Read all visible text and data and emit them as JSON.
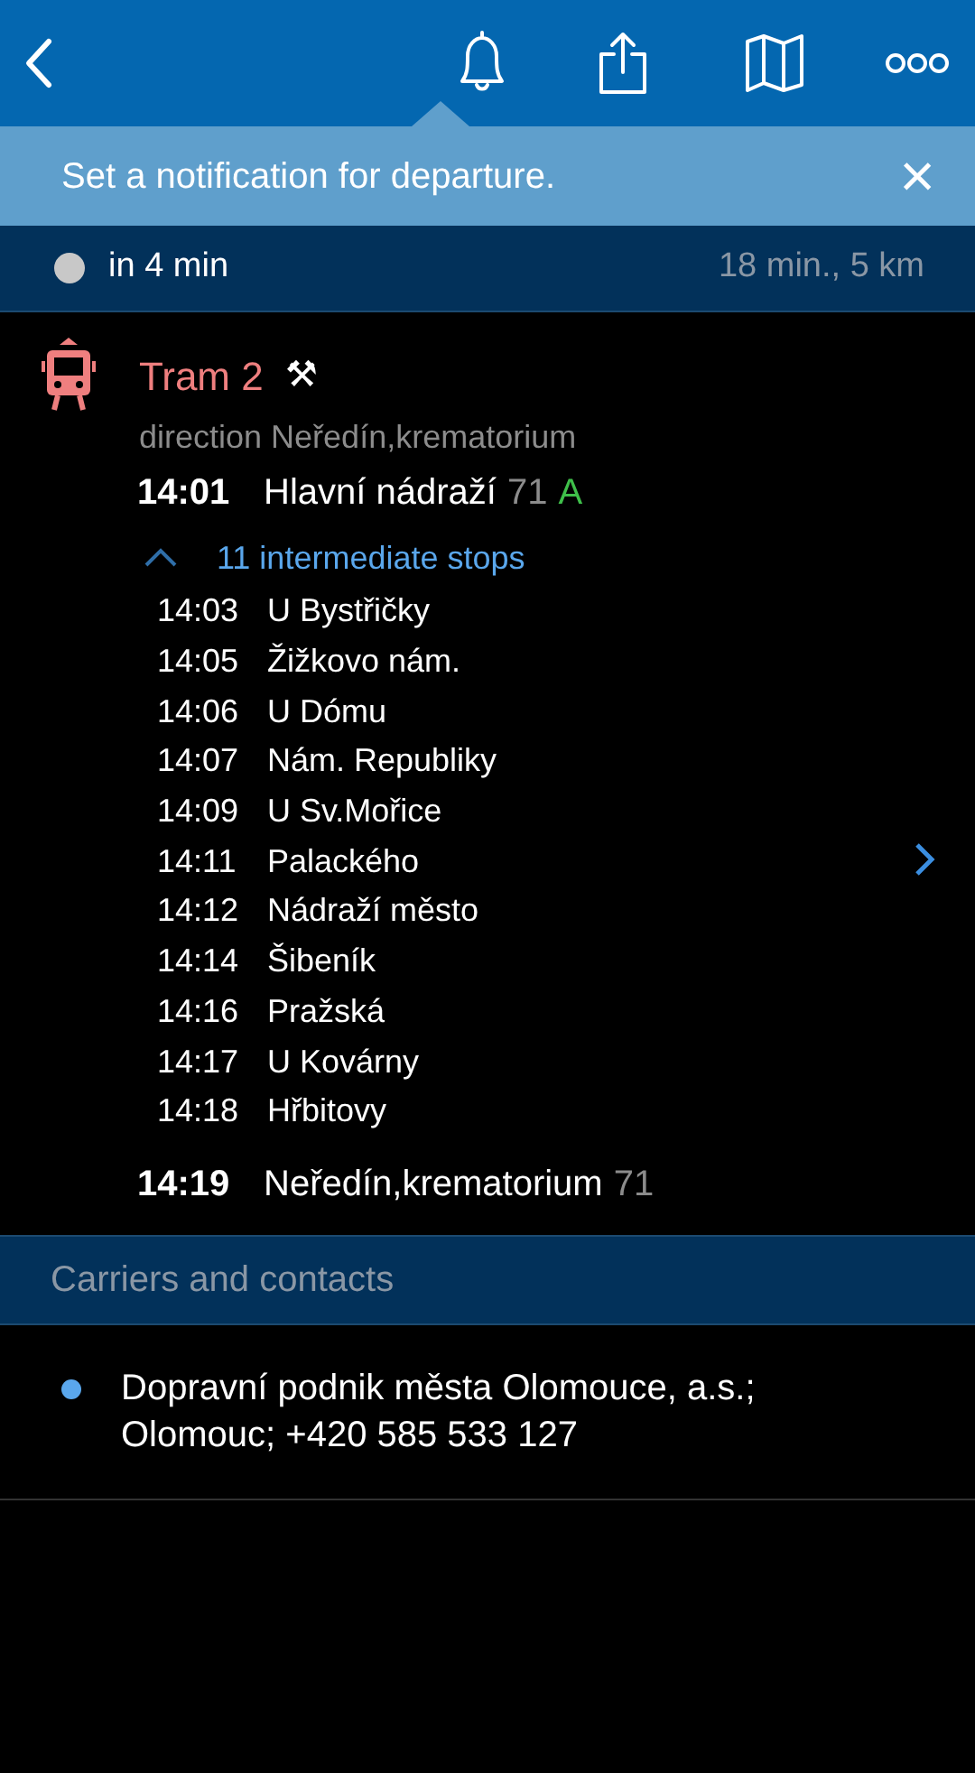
{
  "banner": {
    "text": "Set a notification for departure.",
    "close": "×"
  },
  "status": {
    "departure": "in 4 min",
    "summary": "18 min., 5 km"
  },
  "trip": {
    "line": "Tram 2",
    "line_symbol": "⚒",
    "direction": "direction Neředín,krematorium",
    "start": {
      "time": "14:01",
      "stop": "Hlavní nádraží",
      "code": "71",
      "platform": "A"
    },
    "intermediate": {
      "label": "11 intermediate stops",
      "expanded": true,
      "stops": [
        {
          "time": "14:03",
          "stop": "U Bystřičky"
        },
        {
          "time": "14:05",
          "stop": "Žižkovo nám."
        },
        {
          "time": "14:06",
          "stop": "U Dómu"
        },
        {
          "time": "14:07",
          "stop": "Nám. Republiky"
        },
        {
          "time": "14:09",
          "stop": "U Sv.Mořice"
        },
        {
          "time": "14:11",
          "stop": "Palackého"
        },
        {
          "time": "14:12",
          "stop": "Nádraží město"
        },
        {
          "time": "14:14",
          "stop": "Šibeník"
        },
        {
          "time": "14:16",
          "stop": "Pražská"
        },
        {
          "time": "14:17",
          "stop": "U Kovárny"
        },
        {
          "time": "14:18",
          "stop": "Hřbitovy"
        }
      ]
    },
    "end": {
      "time": "14:19",
      "stop": "Neředín,krematorium",
      "code": "71"
    }
  },
  "carriers": {
    "title": "Carriers and contacts",
    "items": [
      "Dopravní podnik města Olomouce, a.s.; Olomouc; +420 585 533 127"
    ]
  }
}
